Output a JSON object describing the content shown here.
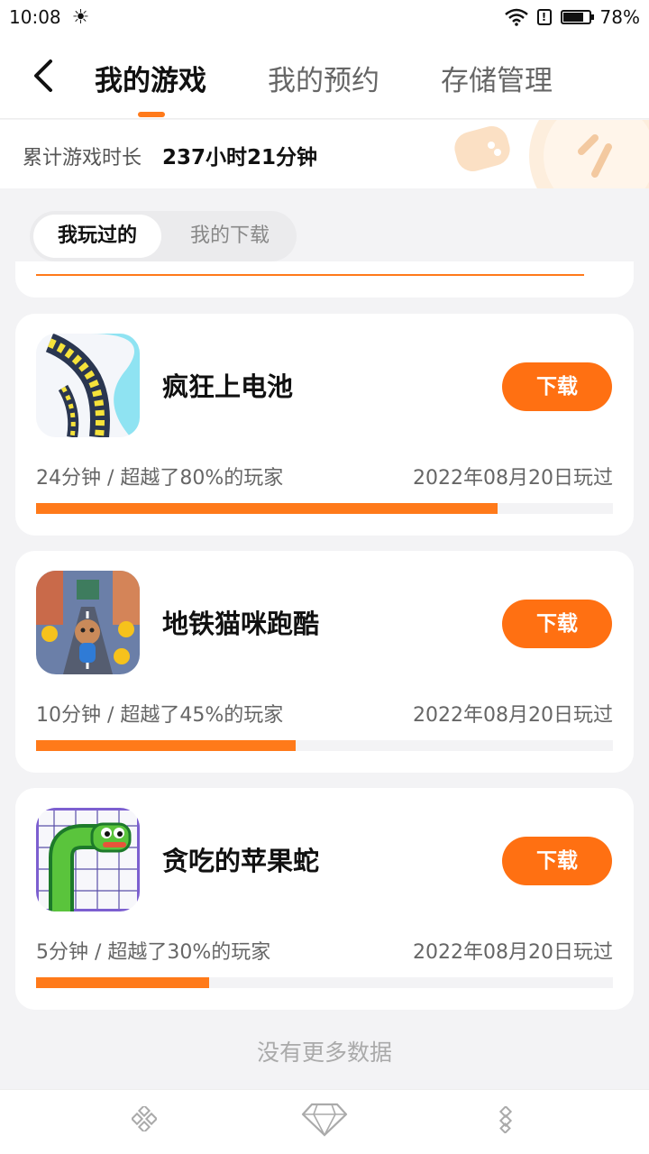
{
  "status": {
    "time": "10:08",
    "battery": "78%"
  },
  "nav": {
    "tabs": [
      {
        "label": "我的游戏",
        "active": true
      },
      {
        "label": "我的预约",
        "active": false
      },
      {
        "label": "存储管理",
        "active": false
      }
    ]
  },
  "summary": {
    "label": "累计游戏时长",
    "value": "237小时21分钟"
  },
  "segment": {
    "played": "我玩过的",
    "downloads": "我的下载"
  },
  "games": [
    {
      "name": "疯狂上电池",
      "stats": "24分钟 / 超越了80%的玩家",
      "date": "2022年08月20日玩过",
      "progress": 0.8,
      "button": "下载",
      "icon": "battery-road-game-icon"
    },
    {
      "name": "地铁猫咪跑酷",
      "stats": "10分钟 / 超越了45%的玩家",
      "date": "2022年08月20日玩过",
      "progress": 0.45,
      "button": "下载",
      "icon": "subway-cat-game-icon"
    },
    {
      "name": "贪吃的苹果蛇",
      "stats": "5分钟 / 超越了30%的玩家",
      "date": "2022年08月20日玩过",
      "progress": 0.3,
      "button": "下载",
      "icon": "apple-snake-game-icon"
    }
  ],
  "footer": {
    "no_more": "没有更多数据"
  },
  "colors": {
    "accent": "#ff7012",
    "progress": "#ff7a1a"
  }
}
